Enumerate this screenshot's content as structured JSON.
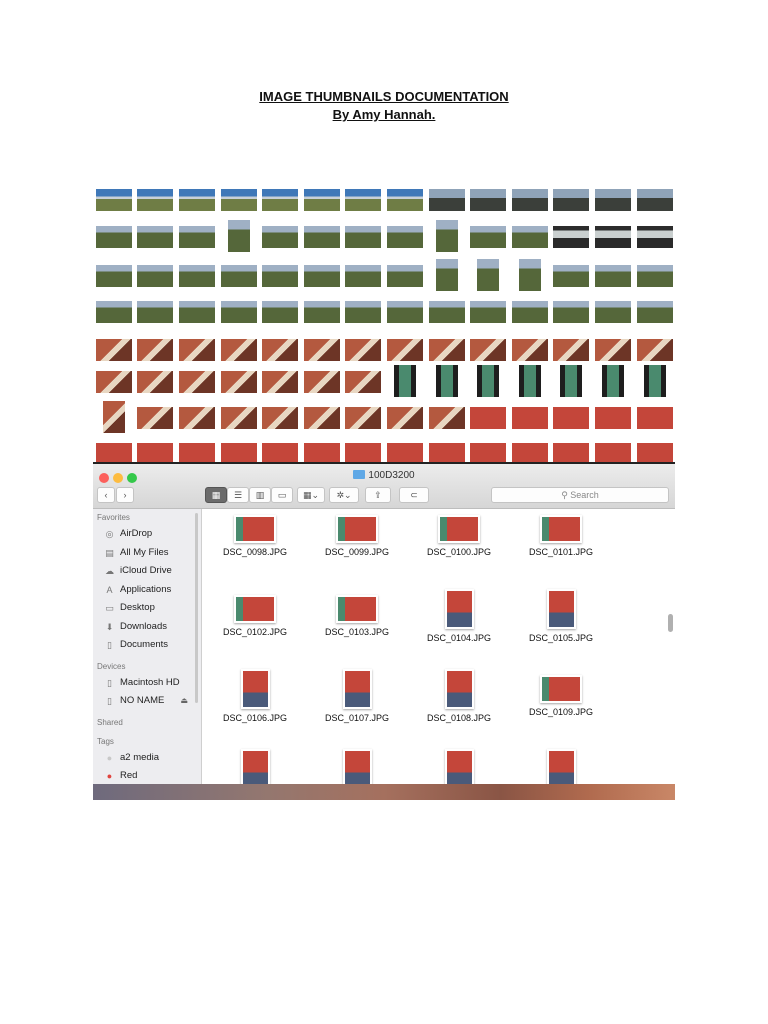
{
  "document": {
    "title": "IMAGE THUMBNAILS DOCUMENTATION",
    "byline": "By Amy Hannah."
  },
  "finder": {
    "window_title": "100D3200",
    "search_placeholder": "Search",
    "sidebar": {
      "sections": [
        {
          "heading": "Favorites",
          "items": [
            {
              "label": "AirDrop",
              "icon": "airdrop-icon"
            },
            {
              "label": "All My Files",
              "icon": "all-files-icon"
            },
            {
              "label": "iCloud Drive",
              "icon": "cloud-icon"
            },
            {
              "label": "Applications",
              "icon": "applications-icon"
            },
            {
              "label": "Desktop",
              "icon": "desktop-icon"
            },
            {
              "label": "Downloads",
              "icon": "download-icon"
            },
            {
              "label": "Documents",
              "icon": "documents-icon"
            }
          ]
        },
        {
          "heading": "Devices",
          "items": [
            {
              "label": "Macintosh HD",
              "icon": "disk-icon"
            },
            {
              "label": "NO NAME",
              "icon": "disk-icon"
            }
          ]
        },
        {
          "heading": "Shared",
          "items": []
        },
        {
          "heading": "Tags",
          "items": [
            {
              "label": "a2 media",
              "icon": "tag-gray-icon"
            },
            {
              "label": "Red",
              "icon": "tag-red-icon"
            }
          ]
        }
      ]
    },
    "files": [
      {
        "name": "DSC_0098.JPG",
        "orientation": "landscape"
      },
      {
        "name": "DSC_0099.JPG",
        "orientation": "landscape"
      },
      {
        "name": "DSC_0100.JPG",
        "orientation": "landscape"
      },
      {
        "name": "DSC_0101.JPG",
        "orientation": "landscape"
      },
      {
        "name": "DSC_0102.JPG",
        "orientation": "landscape"
      },
      {
        "name": "DSC_0103.JPG",
        "orientation": "landscape"
      },
      {
        "name": "DSC_0104.JPG",
        "orientation": "portrait"
      },
      {
        "name": "DSC_0105.JPG",
        "orientation": "portrait"
      },
      {
        "name": "DSC_0106.JPG",
        "orientation": "portrait"
      },
      {
        "name": "DSC_0107.JPG",
        "orientation": "portrait"
      },
      {
        "name": "DSC_0108.JPG",
        "orientation": "portrait"
      },
      {
        "name": "DSC_0109.JPG",
        "orientation": "landscape"
      },
      {
        "name": "",
        "orientation": "portrait"
      },
      {
        "name": "",
        "orientation": "portrait"
      },
      {
        "name": "",
        "orientation": "portrait"
      },
      {
        "name": "",
        "orientation": "portrait"
      }
    ]
  },
  "colors": {
    "sky": "#3f78b8",
    "field": "#6f7d45",
    "interior": "#b4593f",
    "window_light": "#4a8a6e"
  }
}
